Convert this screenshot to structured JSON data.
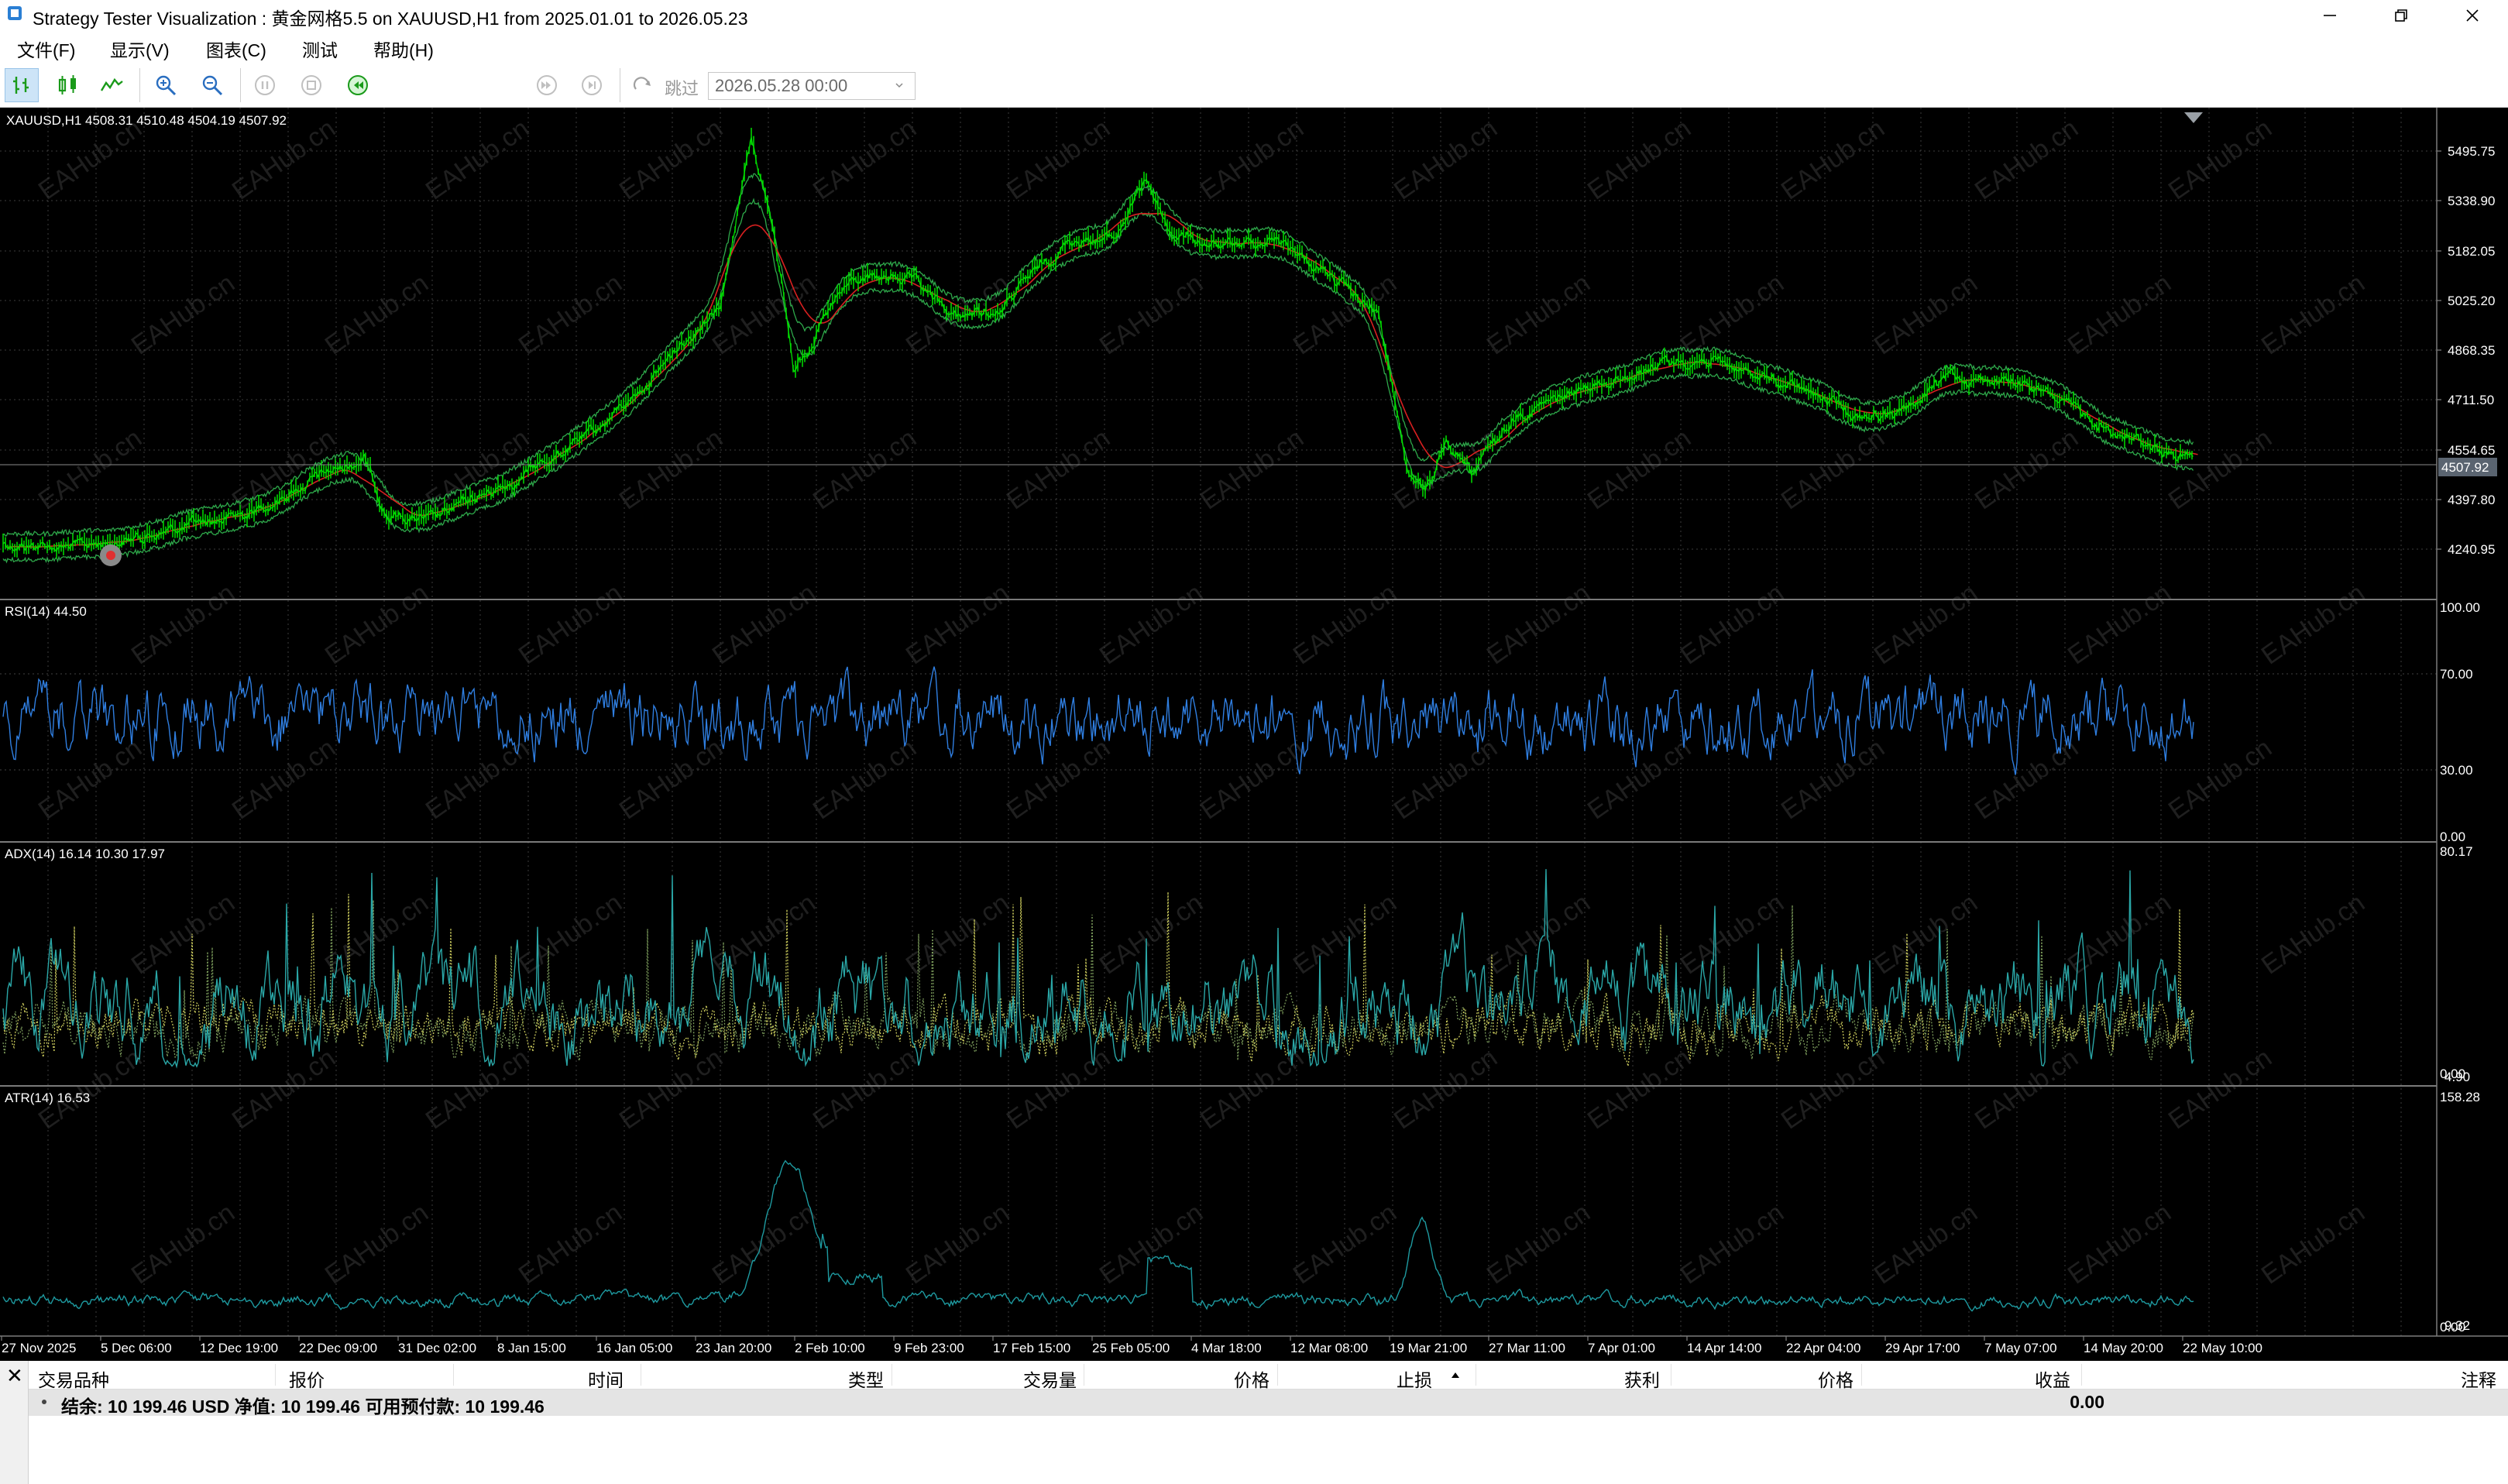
{
  "window": {
    "title": "Strategy Tester Visualization : 黄金网格5.5 on XAUUSD,H1 from 2025.01.01 to 2026.05.23",
    "controls": [
      "minimize",
      "maximize",
      "close"
    ]
  },
  "menu": [
    {
      "label": "文件(F)"
    },
    {
      "label": "显示(V)"
    },
    {
      "label": "图表(C)"
    },
    {
      "label": "测试"
    },
    {
      "label": "帮助(H)"
    }
  ],
  "toolbar": {
    "skip_label": "跳过",
    "date_value": "2026.05.28 00:00",
    "icons": [
      "bar-chart-icon",
      "candlestick-icon",
      "line-chart-icon",
      "zoom-in-icon",
      "zoom-out-icon",
      "pause-icon",
      "stop-icon",
      "slow-down-icon",
      "fast-forward-icon",
      "step-icon",
      "skip-icon"
    ]
  },
  "chart": {
    "main": {
      "label": "XAUUSD,H1  4508.31 4510.48 4504.19 4507.92",
      "price_ticks": [
        "5495.75",
        "5338.90",
        "5182.05",
        "5025.20",
        "4868.35",
        "4711.50",
        "4554.65",
        "4397.80",
        "4240.95"
      ],
      "current_price": "4507.92",
      "colors": {
        "candles": "#00e000",
        "ma": "#d82020",
        "envelope": "#2ea84a"
      }
    },
    "rsi": {
      "label": "RSI(14) 44.50",
      "ticks": [
        "100.00",
        "70.00",
        "30.00",
        "0.00"
      ],
      "color": "#2f7ee0"
    },
    "adx": {
      "label": "ADX(14) 16.14 10.30 17.97",
      "ticks": [
        "80.17",
        "0.00"
      ],
      "overlap_tick": "4.90",
      "colors": {
        "adx": "#2aa7a7",
        "plus_di": "#c6c65a",
        "minus_di": "#7a9a5a"
      }
    },
    "atr": {
      "label": "ATR(14) 16.53",
      "ticks": [
        "158.28",
        "0.00"
      ],
      "overlap_tick": "9.32",
      "color": "#1e9aa0"
    },
    "time_labels": [
      "27 Nov 2025",
      "5 Dec 06:00",
      "12 Dec 19:00",
      "22 Dec 09:00",
      "31 Dec 02:00",
      "8 Jan 15:00",
      "16 Jan 05:00",
      "23 Jan 20:00",
      "2 Feb 10:00",
      "9 Feb 23:00",
      "17 Feb 15:00",
      "25 Feb 05:00",
      "4 Mar 18:00",
      "12 Mar 08:00",
      "19 Mar 21:00",
      "27 Mar 11:00",
      "7 Apr 01:00",
      "14 Apr 14:00",
      "22 Apr 04:00",
      "29 Apr 17:00",
      "7 May 07:00",
      "14 May 20:00",
      "22 May 10:00"
    ],
    "watermark": "EAHub.cn"
  },
  "toolbox": {
    "columns": [
      "交易品种",
      "报价",
      "时间",
      "类型",
      "交易量",
      "价格",
      "止损",
      "获利",
      "价格",
      "收益",
      "注释"
    ],
    "balance_text": "结余: 10 199.46 USD  净值: 10 199.46  可用预付款: 10 199.46",
    "profit": "0.00"
  }
}
